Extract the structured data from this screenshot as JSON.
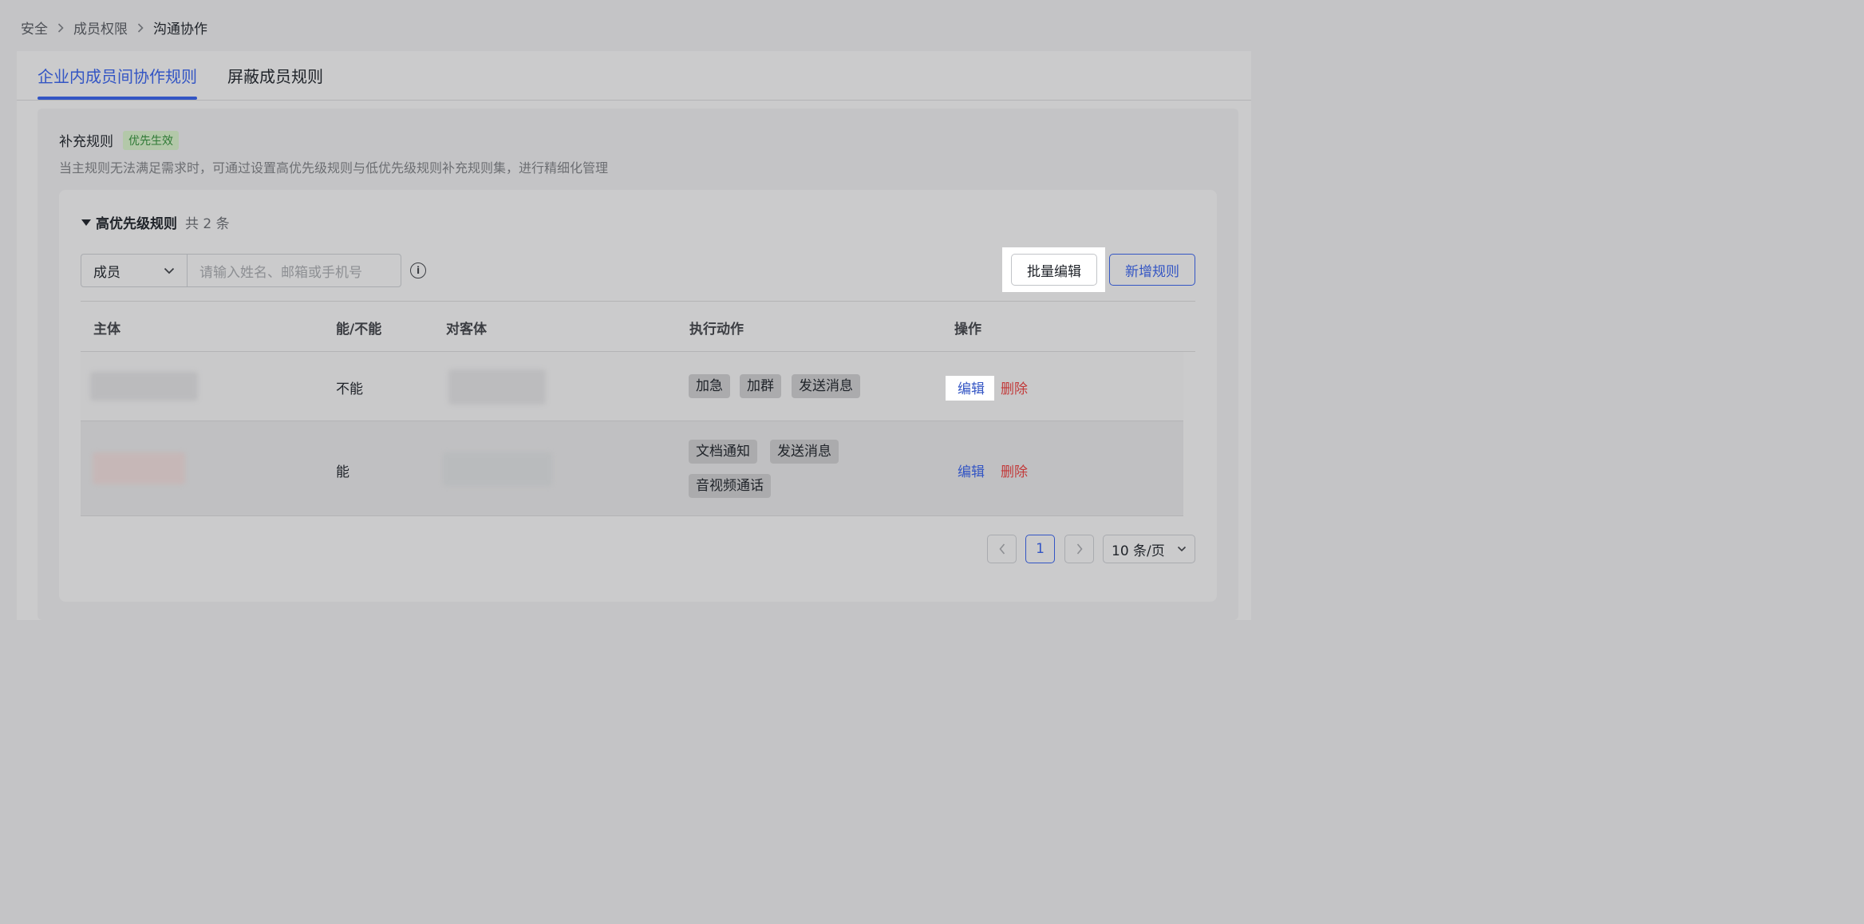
{
  "breadcrumb": {
    "items": [
      "安全",
      "成员权限",
      "沟通协作"
    ]
  },
  "tabs": [
    {
      "label": "企业内成员间协作规则",
      "active": true
    },
    {
      "label": "屏蔽成员规则",
      "active": false
    }
  ],
  "section": {
    "title": "补充规则",
    "badge": "优先生效",
    "description": "当主规则无法满足需求时，可通过设置高优先级规则与低优先级规则补充规则集，进行精细化管理"
  },
  "group": {
    "title": "高优先级规则",
    "count_text": "共 2 条"
  },
  "filter": {
    "select_value": "成员",
    "placeholder": "请输入姓名、邮箱或手机号"
  },
  "toolbar": {
    "batch_edit": "批量编辑",
    "add_rule": "新增规则"
  },
  "table": {
    "headers": [
      "主体",
      "能/不能",
      "对客体",
      "执行动作",
      "操作"
    ],
    "rows": [
      {
        "permission": "不能",
        "actions": [
          "加急",
          "加群",
          "发送消息"
        ],
        "edit": "编辑",
        "delete": "删除"
      },
      {
        "permission": "能",
        "actions": [
          "文档通知",
          "发送消息",
          "音视频通话"
        ],
        "edit": "编辑",
        "delete": "删除"
      }
    ]
  },
  "pagination": {
    "current_page": "1",
    "page_size": "10 条/页"
  },
  "colors": {
    "accent": "#3355c4",
    "danger": "#c23a3a",
    "badge_text": "#2f7a36"
  }
}
